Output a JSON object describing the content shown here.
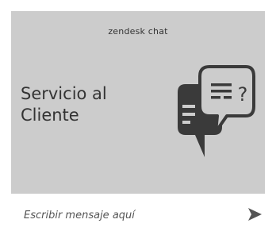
{
  "banner": {
    "brand": "zendesk chat",
    "headline_line1": "Servicio al",
    "headline_line2": "Cliente",
    "icon": "chat-bubbles-question-icon"
  },
  "composer": {
    "placeholder": "Escribir mensaje aquí",
    "send_icon": "send-arrow-icon"
  },
  "colors": {
    "banner_bg": "#cccccc",
    "text": "#333333",
    "icon_dark": "#3a3a3a",
    "page_bg": "#ffffff"
  }
}
